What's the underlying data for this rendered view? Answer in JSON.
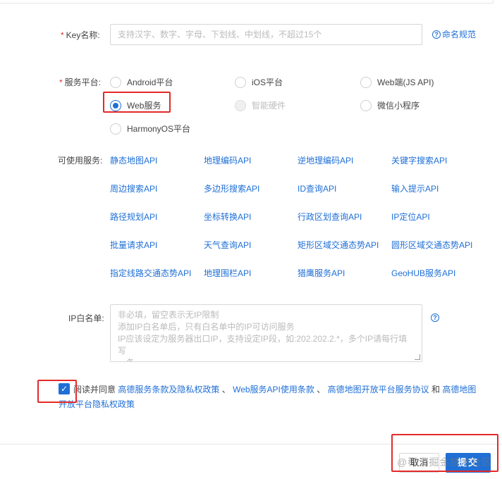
{
  "form": {
    "key_label": "Key名称:",
    "key_required": "*",
    "key_placeholder": "支持汉字、数字、字母、下划线、中划线，不超过15个",
    "naming_rule_link": "命名规范",
    "platform_label": "服务平台:",
    "platform_required": "*",
    "platforms": [
      {
        "label": "Android平台",
        "checked": false,
        "disabled": false
      },
      {
        "label": "iOS平台",
        "checked": false,
        "disabled": false
      },
      {
        "label": "Web端(JS API)",
        "checked": false,
        "disabled": false
      },
      {
        "label": "Web服务",
        "checked": true,
        "disabled": false
      },
      {
        "label": "智能硬件",
        "checked": false,
        "disabled": true
      },
      {
        "label": "微信小程序",
        "checked": false,
        "disabled": false
      },
      {
        "label": "HarmonyOS平台",
        "checked": false,
        "disabled": false
      }
    ],
    "services_label": "可使用服务:",
    "services": [
      "静态地图API",
      "地理编码API",
      "逆地理编码API",
      "关键字搜索API",
      "周边搜索API",
      "多边形搜索API",
      "ID查询API",
      "输入提示API",
      "路径规划API",
      "坐标转换API",
      "行政区划查询API",
      "IP定位API",
      "批量请求API",
      "天气查询API",
      "矩形区域交通态势API",
      "圆形区域交通态势API",
      "指定线路交通态势API",
      "地理围栏API",
      "猎鹰服务API",
      "GeoHUB服务API"
    ],
    "ip_label": "IP白名单:",
    "ip_placeholder_lines": [
      "非必填，留空表示无IP限制",
      "添加IP白名单后，只有白名单中的IP可访问服务",
      "IP应该设定为服务器出口IP，支持设定IP段，如:202.202.2.*，多个IP请每行填写",
      "一条"
    ],
    "agree": {
      "checked": true,
      "prefix": "阅读并同意",
      "link1": "高德服务条款及隐私权政策",
      "sep1": "、",
      "link2": "Web服务API使用条款",
      "sep2": "、",
      "link3": "高德地图开放平台服务协议",
      "and": "和",
      "link4": "高德地图开放平台隐私权政策"
    }
  },
  "footer": {
    "cancel_label": "取消",
    "submit_label": "提交",
    "watermark": "@稀土掘金技术社区"
  },
  "colors": {
    "accent": "#1f6fd6",
    "highlight": "#e32a2a",
    "required": "#e03030"
  }
}
